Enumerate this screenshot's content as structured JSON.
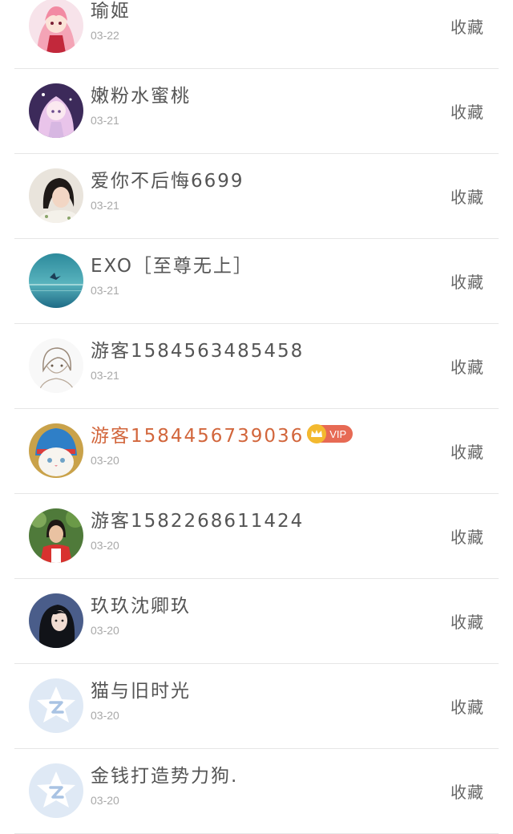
{
  "rows": [
    {
      "name": "瑜姬",
      "date": "03-22",
      "action": "收藏",
      "avatar": "anime-girl-red-avatar",
      "vip": false
    },
    {
      "name": "嫩粉水蜜桃",
      "date": "03-21",
      "action": "收藏",
      "avatar": "anime-girl-purple-avatar",
      "vip": false
    },
    {
      "name": "爱你不后悔6699",
      "date": "03-21",
      "action": "收藏",
      "avatar": "photo-girl-avatar",
      "vip": false
    },
    {
      "name": "EXO［至尊无上］",
      "date": "03-21",
      "action": "收藏",
      "avatar": "ocean-avatar",
      "vip": false
    },
    {
      "name": "游客1584563485458",
      "date": "03-21",
      "action": "收藏",
      "avatar": "sketch-boy-avatar",
      "vip": false
    },
    {
      "name": "游客1584456739036",
      "date": "03-20",
      "action": "收藏",
      "avatar": "cat-avatar",
      "vip": true,
      "vip_label": "VIP"
    },
    {
      "name": "游客1582268611424",
      "date": "03-20",
      "action": "收藏",
      "avatar": "outdoor-girl-avatar",
      "vip": false
    },
    {
      "name": "玖玖沈卿玖",
      "date": "03-20",
      "action": "收藏",
      "avatar": "dark-hair-girl-avatar",
      "vip": false
    },
    {
      "name": "猫与旧时光",
      "date": "03-20",
      "action": "收藏",
      "avatar": "default-qzone-avatar",
      "vip": false
    },
    {
      "name": "金钱打造势力狗.",
      "date": "03-20",
      "action": "收藏",
      "avatar": "default-qzone-avatar",
      "vip": false
    }
  ],
  "colors": {
    "name_text": "#555555",
    "vip_name_text": "#d2663c",
    "date_text": "#a8a8a8",
    "divider": "#e6e6e6",
    "vip_badge": "#e76a54",
    "crown": "#f3b92f",
    "default_avatar_bg": "#dfe9f5"
  }
}
